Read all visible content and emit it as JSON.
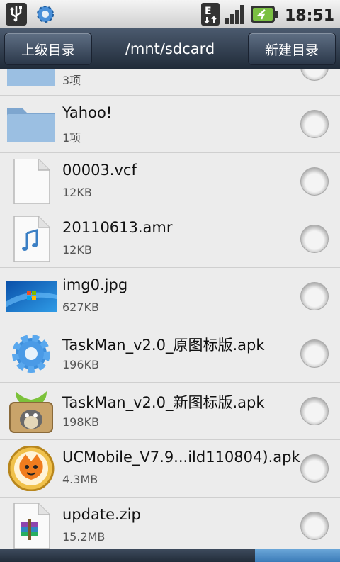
{
  "status_bar": {
    "time": "18:51",
    "network": "E",
    "icons": [
      "usb-icon",
      "gear-icon",
      "edge-network-icon",
      "signal-icon",
      "battery-icon"
    ]
  },
  "toolbar": {
    "up_label": "上级目录",
    "path": "/mnt/sdcard",
    "new_folder_label": "新建目录"
  },
  "files": [
    {
      "name": "",
      "meta": "3项",
      "icon": "folder-icon"
    },
    {
      "name": "Yahoo!",
      "meta": "1项",
      "icon": "folder-icon"
    },
    {
      "name": "00003.vcf",
      "meta": "12KB",
      "icon": "document-icon"
    },
    {
      "name": "20110613.amr",
      "meta": "12KB",
      "icon": "audio-file-icon"
    },
    {
      "name": "img0.jpg",
      "meta": "627KB",
      "icon": "image-thumbnail-icon"
    },
    {
      "name": "TaskMan_v2.0_原图标版.apk",
      "meta": "196KB",
      "icon": "gear-app-icon"
    },
    {
      "name": "TaskMan_v2.0_新图标版.apk",
      "meta": "198KB",
      "icon": "taskman-app-icon"
    },
    {
      "name": "UCMobile_V7.9...ild110804).apk",
      "meta": "4.3MB",
      "icon": "ucbrowser-app-icon"
    },
    {
      "name": "update.zip",
      "meta": "15.2MB",
      "icon": "zip-archive-icon"
    }
  ],
  "colors": {
    "toolbar": "#2b384a",
    "list_bg": "#ececec",
    "folder": "#8fb3d6",
    "active_tab": "#4f8fcb"
  }
}
